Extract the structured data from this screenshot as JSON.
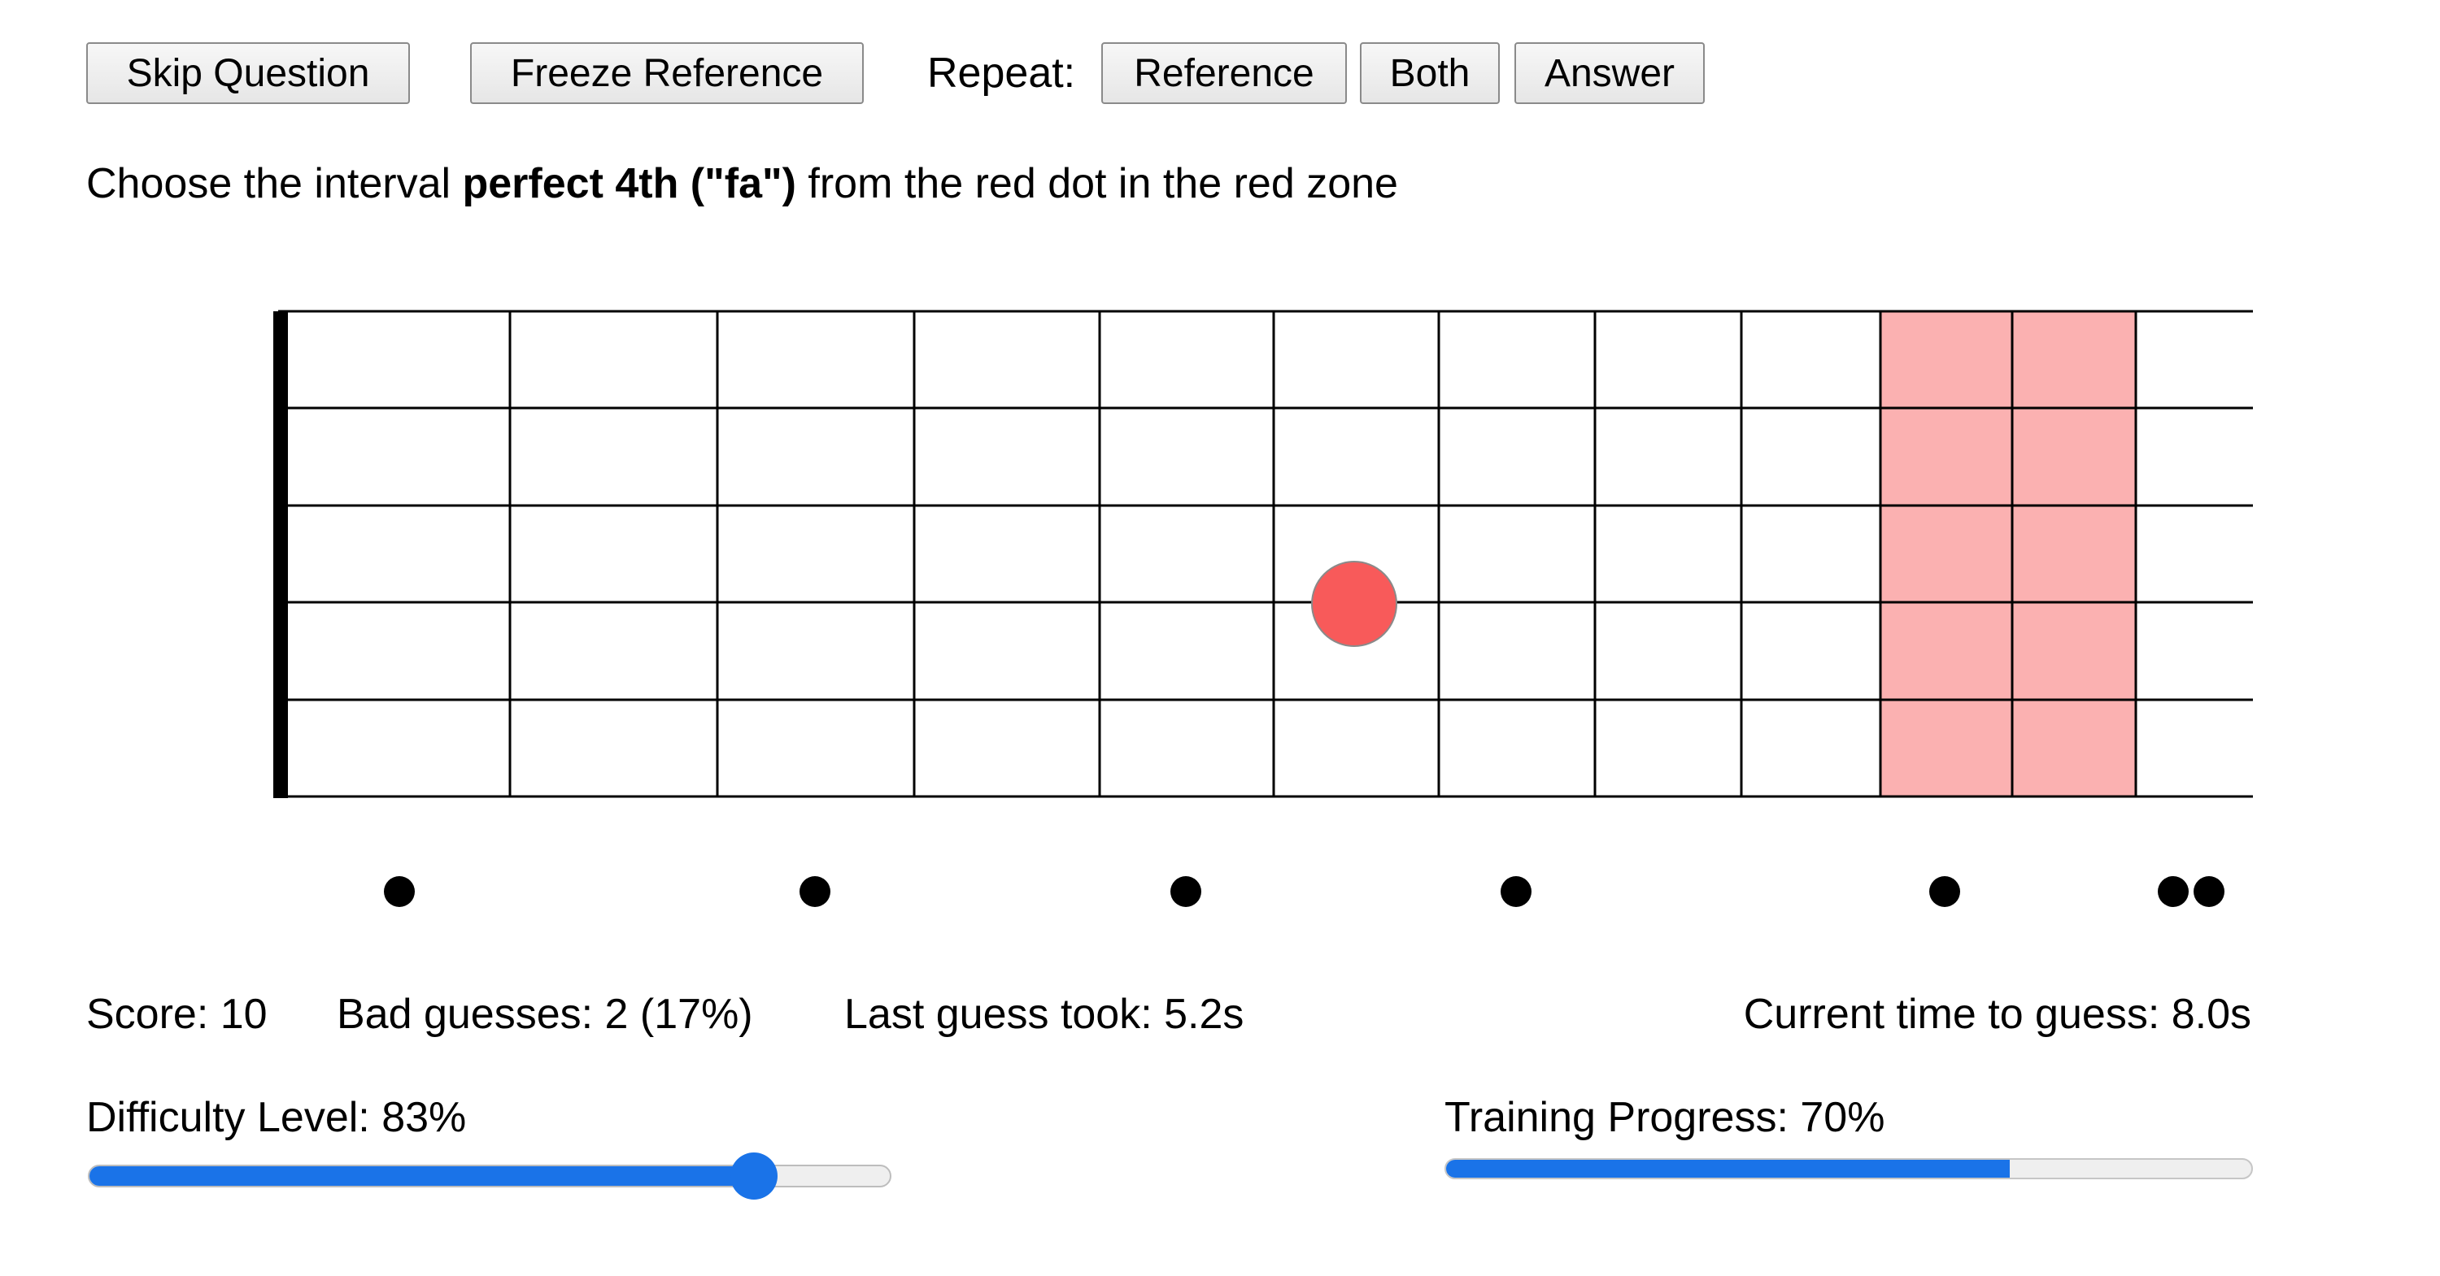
{
  "toolbar": {
    "skip_label": "Skip Question",
    "freeze_label": "Freeze Reference",
    "repeat_label": "Repeat:",
    "reference_label": "Reference",
    "both_label": "Both",
    "answer_label": "Answer"
  },
  "prompt": {
    "before": "Choose the interval ",
    "interval": "perfect 4th (\"fa\")",
    "after": " from the red dot in the red zone"
  },
  "fretboard": {
    "strings": 6,
    "frets_visible": 11,
    "inlay_frets": [
      3,
      5,
      7,
      9,
      12
    ],
    "double_inlay_fret": 12,
    "red_dot": {
      "string": 4,
      "fret": 6
    },
    "red_zone_frets": [
      10,
      11
    ],
    "colors": {
      "zone": "#fbb1b1",
      "dot": "#f85a5a",
      "lines": "#000000"
    }
  },
  "stats": {
    "score": "Score: 10",
    "bad_guesses": "Bad guesses: 2 (17%)",
    "last_guess": "Last guess took: 5.2s",
    "current_time": "Current time to guess: 8.0s"
  },
  "difficulty": {
    "label": "Difficulty Level: 83%",
    "value": 0.83
  },
  "training": {
    "label": "Training Progress: 70%",
    "value": 0.7
  },
  "colors": {
    "accent": "#1a73e8"
  }
}
